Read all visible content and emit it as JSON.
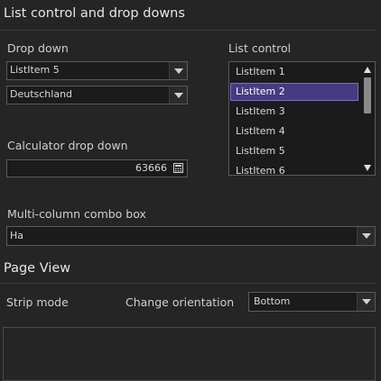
{
  "list_section": {
    "title": "List control and drop downs"
  },
  "dropdown": {
    "label": "Drop down",
    "value1": "ListItem 5",
    "value2": "Deutschland"
  },
  "list_control": {
    "label": "List control",
    "items": [
      "ListItem 1",
      "ListItem 2",
      "ListItem 3",
      "ListItem 4",
      "ListItem 5",
      "ListItem 6"
    ],
    "selected_index": 1
  },
  "calculator": {
    "label": "Calculator drop down",
    "value": "63666",
    "icon": "calculator-icon"
  },
  "multicolumn": {
    "label": "Multi-column combo box",
    "value": "Ha"
  },
  "page_view": {
    "title": "Page View",
    "strip_mode_label": "Strip mode",
    "orientation_label": "Change orientation",
    "orientation_value": "Bottom"
  },
  "colors": {
    "background": "#252526",
    "selection": "#473a80",
    "field_bg": "#1b1b1c",
    "border": "#5a5a5a"
  }
}
